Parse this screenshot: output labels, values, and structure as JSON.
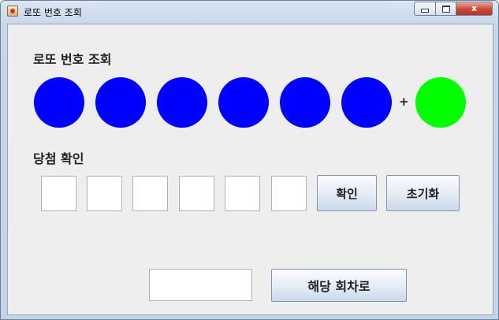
{
  "window": {
    "title": "로또 번호 조회",
    "min_label": "",
    "max_label": "",
    "close_label": "x"
  },
  "lotto": {
    "heading": "로또 번호 조회",
    "ball_color": "#0000ff",
    "bonus_color": "#00ff00",
    "plus": "+"
  },
  "check": {
    "heading": "당첨 확인",
    "confirm_label": "확인",
    "reset_label": "초기화"
  },
  "round": {
    "value": "",
    "go_label": "해당 회차로"
  }
}
